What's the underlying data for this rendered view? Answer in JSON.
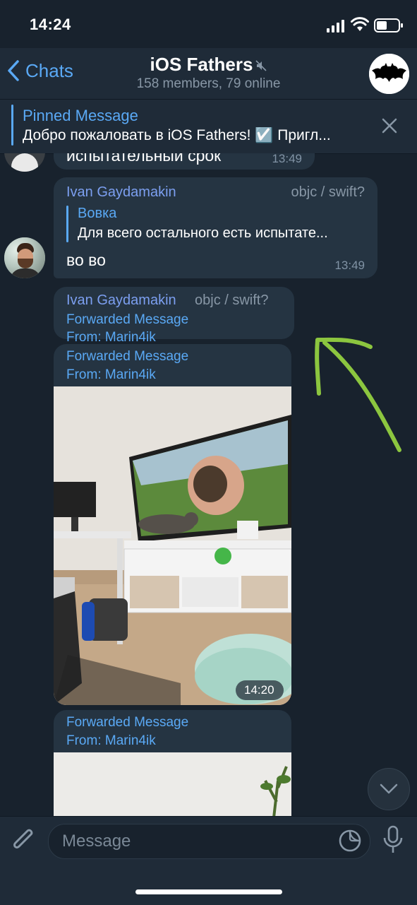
{
  "status_bar": {
    "time": "14:24"
  },
  "header": {
    "back_label": "Chats",
    "title": "iOS Fathers",
    "subtitle": "158 members, 79 online"
  },
  "pinned": {
    "title": "Pinned Message",
    "text": "Добро пожаловать в iOS Fathers! ☑️ Пригл..."
  },
  "messages": [
    {
      "text": "испытательный срок",
      "time": "13:49"
    },
    {
      "sender": "Ivan Gaydamakin",
      "tag": "objc / swift?",
      "reply_author": "Вовка",
      "reply_text": "Для всего остального есть испытате...",
      "text": "во во",
      "time": "13:49"
    },
    {
      "sender": "Ivan Gaydamakin",
      "tag": "objc / swift?",
      "fwd_label": "Forwarded Message",
      "fwd_from_prefix": "From: ",
      "fwd_from": "Marin4ik"
    },
    {
      "fwd_label": "Forwarded Message",
      "fwd_from_prefix": "From: ",
      "fwd_from": "Marin4ik",
      "time": "14:20"
    },
    {
      "fwd_label": "Forwarded Message",
      "fwd_from_prefix": "From: ",
      "fwd_from": "Marin4ik"
    }
  ],
  "composer": {
    "placeholder": "Message"
  },
  "icons": [
    "back-chevron-icon",
    "mute-icon",
    "close-icon",
    "attach-icon",
    "sticker-icon",
    "mic-icon",
    "chevron-down-icon",
    "signal-icon",
    "wifi-icon",
    "battery-icon"
  ],
  "colors": {
    "accent": "#5aa9f5",
    "background": "#18222d",
    "bubble": "#253442",
    "annotation_arrow": "#8cc63f"
  }
}
